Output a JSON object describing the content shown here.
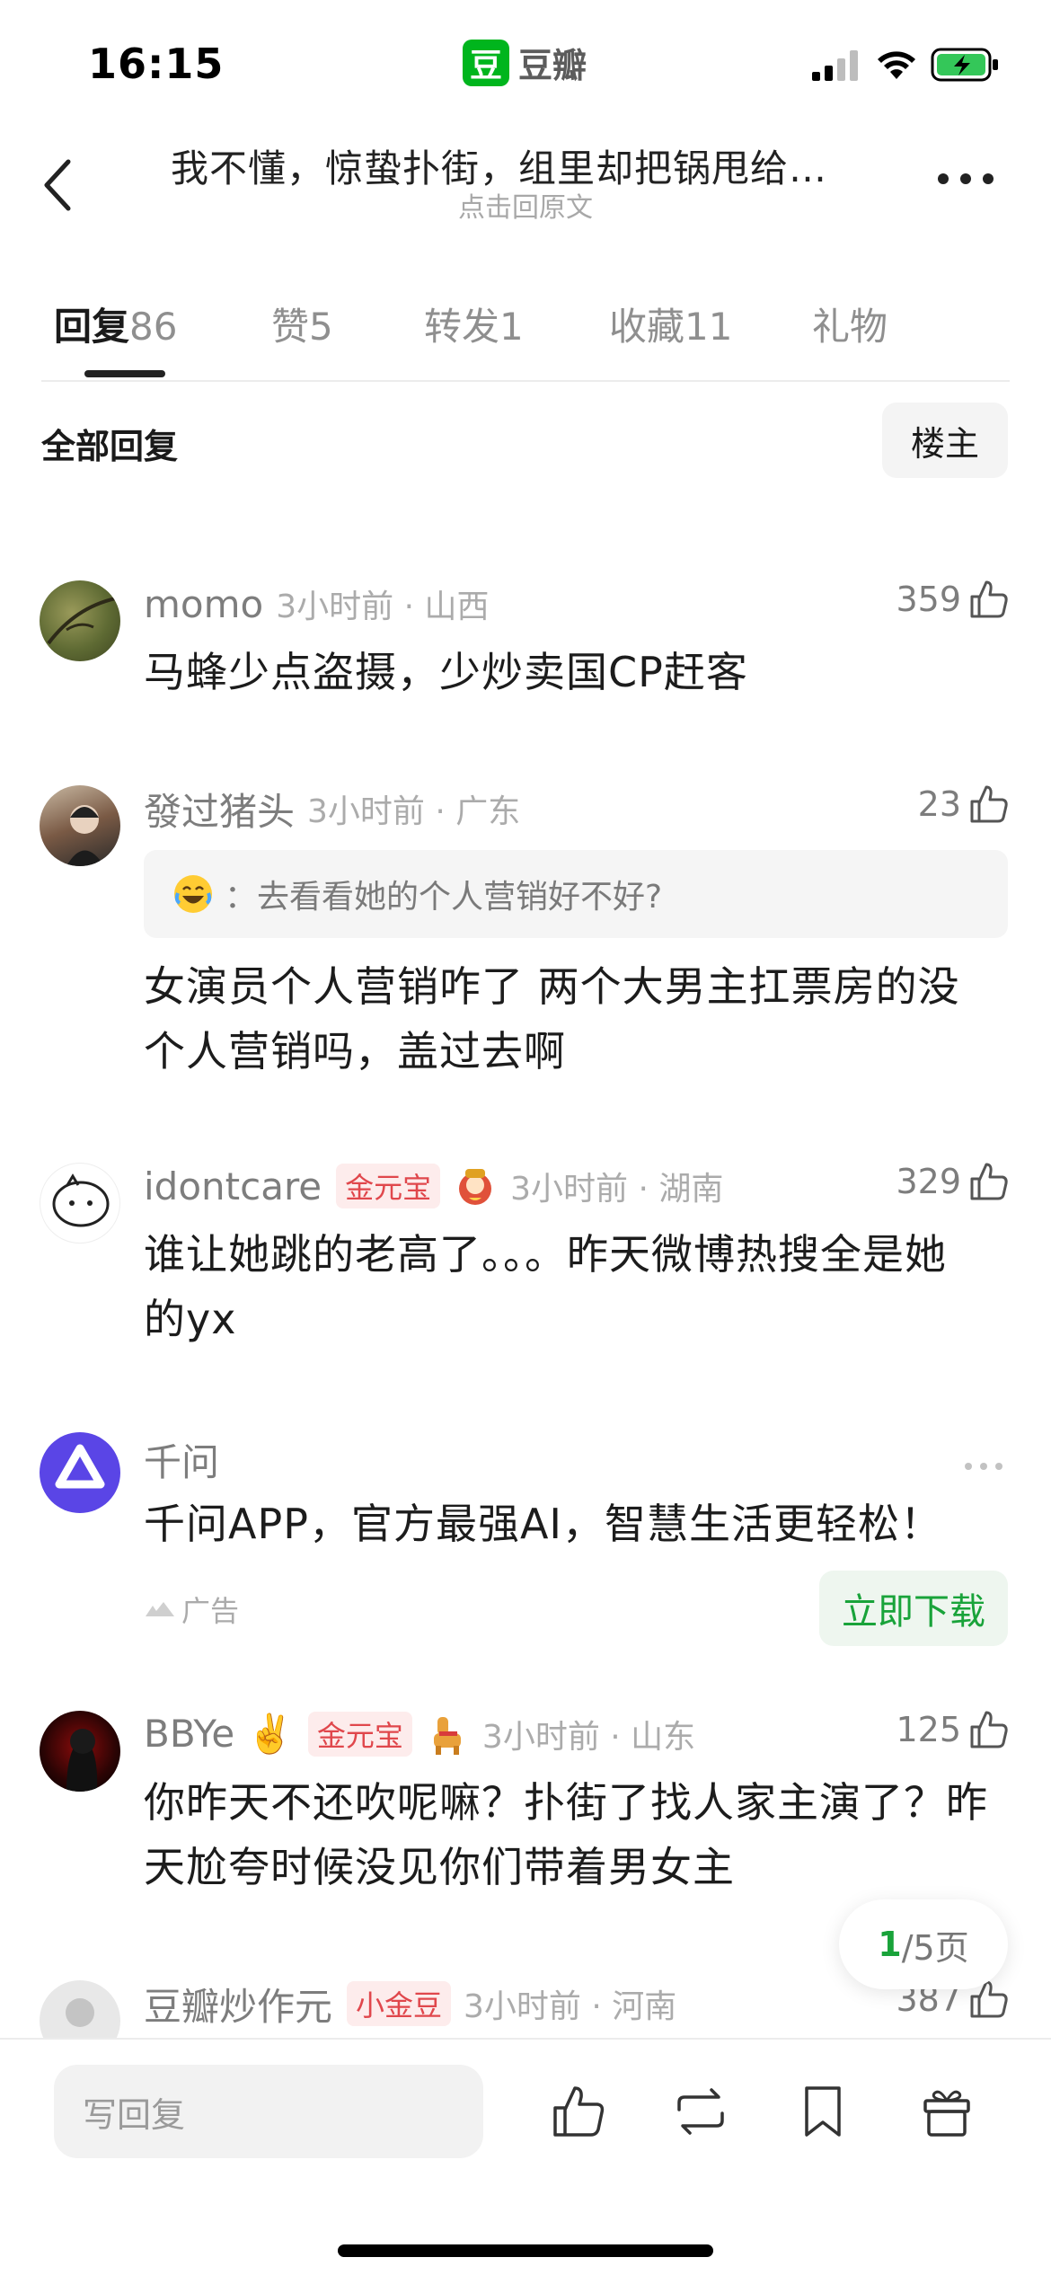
{
  "status_bar": {
    "time": "16:15",
    "app_logo_char": "豆",
    "app_name": "豆瓣"
  },
  "header": {
    "title": "我不懂，惊蛰扑街，组里却把锅甩给…",
    "subtitle": "点击回原文"
  },
  "tabs": [
    {
      "label": "回复",
      "count": "86"
    },
    {
      "label": "赞",
      "count": "5"
    },
    {
      "label": "转发",
      "count": "1"
    },
    {
      "label": "收藏",
      "count": "11"
    },
    {
      "label": "礼物",
      "count": ""
    }
  ],
  "section": {
    "label": "全部回复",
    "op_button": "楼主"
  },
  "comments": [
    {
      "username": "momo",
      "time_loc": "3小时前 · 山西",
      "likes": "359",
      "content": "马蜂少点盗摄，少炒卖国CP赶客"
    },
    {
      "username": "發过猪头",
      "time_loc": "3小时前 · 广东",
      "likes": "23",
      "quote": "：去看看她的个人营销好不好?",
      "content": "女演员个人营销咋了 两个大男主扛票房的没个人营销吗，盖过去啊"
    },
    {
      "username": "idontcare",
      "badge": "金元宝",
      "time_loc": "3小时前 · 湖南",
      "likes": "329",
      "content": "谁让她跳的老高了。。。昨天微博热搜全是她的yx"
    },
    {
      "username": "BBYe ✌️",
      "badge": "金元宝",
      "time_loc": "3小时前 · 山东",
      "likes": "125",
      "content": "你昨天不还吹呢嘛？扑街了找人家主演了？昨天尬夸时候没见你们带着男女主"
    },
    {
      "username": "豆瓣炒作元",
      "badge": "小金豆",
      "time_loc": "3小时前 · 河南",
      "likes": "387",
      "content": ""
    }
  ],
  "ad": {
    "name": "千问",
    "content": "千问APP，官方最强AI，智慧生活更轻松！",
    "tag": "广告",
    "button": "立即下载"
  },
  "pager": {
    "current": "1",
    "total_text": "/5页"
  },
  "bottom_bar": {
    "reply_placeholder": "写回复"
  },
  "colors": {
    "brand_green": "#00b51d",
    "download_green": "#19a33a",
    "badge_red": "#e0474c"
  },
  "icons": [
    "back-icon",
    "more-icon",
    "thumb-up-icon",
    "repost-icon",
    "bookmark-icon",
    "gift-icon",
    "laugh-emoji-icon"
  ]
}
